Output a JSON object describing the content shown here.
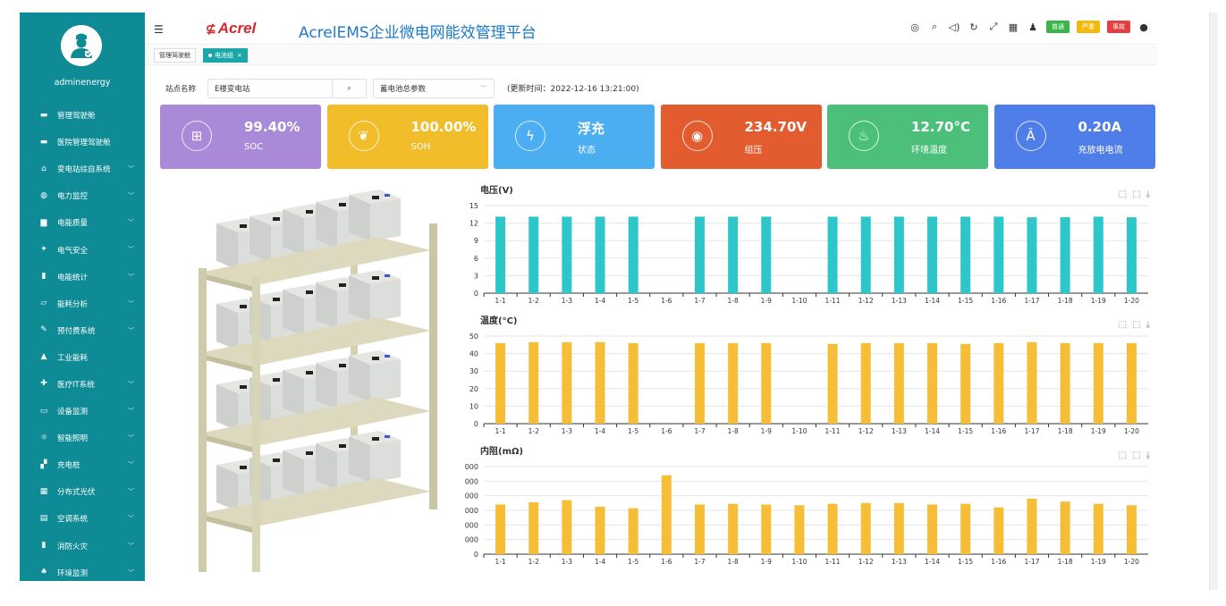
{
  "sidebar": {
    "username": "adminenergy",
    "items": [
      {
        "label": "管理驾驶舱",
        "icon": "monitor-icon",
        "expandable": false
      },
      {
        "label": "医院管理驾驶舱",
        "icon": "monitor-icon",
        "expandable": false
      },
      {
        "label": "变电站综自系统",
        "icon": "home-icon",
        "expandable": true
      },
      {
        "label": "电力监控",
        "icon": "globe-icon",
        "expandable": true
      },
      {
        "label": "电能质量",
        "icon": "bar-chart-icon",
        "expandable": true
      },
      {
        "label": "电气安全",
        "icon": "bulb-icon",
        "expandable": true
      },
      {
        "label": "电能统计",
        "icon": "stats-icon",
        "expandable": true
      },
      {
        "label": "能耗分析",
        "icon": "area-chart-icon",
        "expandable": true
      },
      {
        "label": "预付费系统",
        "icon": "payment-icon",
        "expandable": true
      },
      {
        "label": "工业能耗",
        "icon": "factory-icon",
        "expandable": false
      },
      {
        "label": "医疗IT系统",
        "icon": "hospital-icon",
        "expandable": true
      },
      {
        "label": "设备监测",
        "icon": "device-icon",
        "expandable": true
      },
      {
        "label": "智能照明",
        "icon": "light-icon",
        "expandable": true
      },
      {
        "label": "充电桩",
        "icon": "charger-icon",
        "expandable": true
      },
      {
        "label": "分布式光伏",
        "icon": "solar-icon",
        "expandable": true
      },
      {
        "label": "空调系统",
        "icon": "aircon-icon",
        "expandable": true
      },
      {
        "label": "消防火灾",
        "icon": "fire-icon",
        "expandable": true
      },
      {
        "label": "环境监测",
        "icon": "environment-icon",
        "expandable": true
      }
    ]
  },
  "header": {
    "logo_text": "Acrel",
    "title": "AcrelEMS企业微电网能效管理平台",
    "badges": [
      {
        "label": "普通",
        "color": "#3bb54a"
      },
      {
        "label": "严重",
        "color": "#f4b90c"
      },
      {
        "label": "事故",
        "color": "#e53f3f"
      }
    ]
  },
  "tabs": [
    {
      "label": "管理驾驶舱",
      "active": false
    },
    {
      "label": "电池组",
      "active": true
    }
  ],
  "filter": {
    "station_label": "站点名称",
    "station_value": "E楼变电站",
    "param_value": "蓄电池总参数",
    "update_time": "(更新时间：2022-12-16 13:21:00)"
  },
  "cards": [
    {
      "value": "99.40%",
      "label": "SOC",
      "icon": "battery-icon",
      "color": "#a98ad8"
    },
    {
      "value": "100.00%",
      "label": "SOH",
      "icon": "leaf-icon",
      "color": "#f2bd2b"
    },
    {
      "value": "浮充",
      "label": "状态",
      "icon": "lightning-icon",
      "color": "#4aaef0"
    },
    {
      "value": "234.70V",
      "label": "组压",
      "icon": "gauge-icon",
      "color": "#e25c30"
    },
    {
      "value": "12.70°C",
      "label": "环境温度",
      "icon": "thermometer-icon",
      "color": "#4cc07a"
    },
    {
      "value": "0.20A",
      "label": "充放电电流",
      "icon": "current-icon",
      "color": "#4f7ee8"
    }
  ],
  "chart_data": [
    {
      "type": "bar",
      "title": "电压(V)",
      "color": "#2ec7c9",
      "categories": [
        "1-1",
        "1-2",
        "1-3",
        "1-4",
        "1-5",
        "1-6",
        "1-7",
        "1-8",
        "1-9",
        "1-10",
        "1-11",
        "1-12",
        "1-13",
        "1-14",
        "1-15",
        "1-16",
        "1-17",
        "1-18",
        "1-19",
        "1-20"
      ],
      "values": [
        13.1,
        13.1,
        13.1,
        13.1,
        13.1,
        0,
        13.1,
        13.1,
        13.1,
        0,
        13.1,
        13.1,
        13.1,
        13.1,
        13.1,
        13.1,
        13.0,
        13.0,
        13.1,
        13.0
      ],
      "ylim": [
        0,
        15
      ],
      "yticks": [
        "0",
        "3",
        "6",
        "9",
        "12",
        "15"
      ]
    },
    {
      "type": "bar",
      "title": "温度(°C)",
      "color": "#f5be36",
      "categories": [
        "1-1",
        "1-2",
        "1-3",
        "1-4",
        "1-5",
        "1-6",
        "1-7",
        "1-8",
        "1-9",
        "1-10",
        "1-11",
        "1-12",
        "1-13",
        "1-14",
        "1-15",
        "1-16",
        "1-17",
        "1-18",
        "1-19",
        "1-20"
      ],
      "values": [
        46,
        46.5,
        46.5,
        46.5,
        46,
        0,
        46,
        46,
        46,
        0,
        45.5,
        46,
        46,
        46,
        45.5,
        46,
        46.5,
        46,
        46,
        46
      ],
      "ylim": [
        0,
        50
      ],
      "yticks": [
        "0",
        "10",
        "20",
        "30",
        "40",
        "50"
      ]
    },
    {
      "type": "bar",
      "title": "内阻(mΩ)",
      "color": "#f5be36",
      "categories": [
        "1-1",
        "1-2",
        "1-3",
        "1-4",
        "1-5",
        "1-6",
        "1-7",
        "1-8",
        "1-9",
        "1-10",
        "1-11",
        "1-12",
        "1-13",
        "1-14",
        "1-15",
        "1-16",
        "1-17",
        "1-18",
        "1-19",
        "1-20"
      ],
      "values": [
        0.68,
        0.71,
        0.74,
        0.65,
        0.63,
        1.08,
        0.68,
        0.69,
        0.68,
        0.67,
        0.69,
        0.7,
        0.7,
        0.68,
        0.69,
        0.64,
        0.76,
        0.72,
        0.69,
        0.67
      ],
      "ylim": [
        0,
        1.2
      ],
      "yticks": [
        "0",
        "000",
        "000",
        "000",
        "000",
        "000",
        "000"
      ]
    }
  ]
}
